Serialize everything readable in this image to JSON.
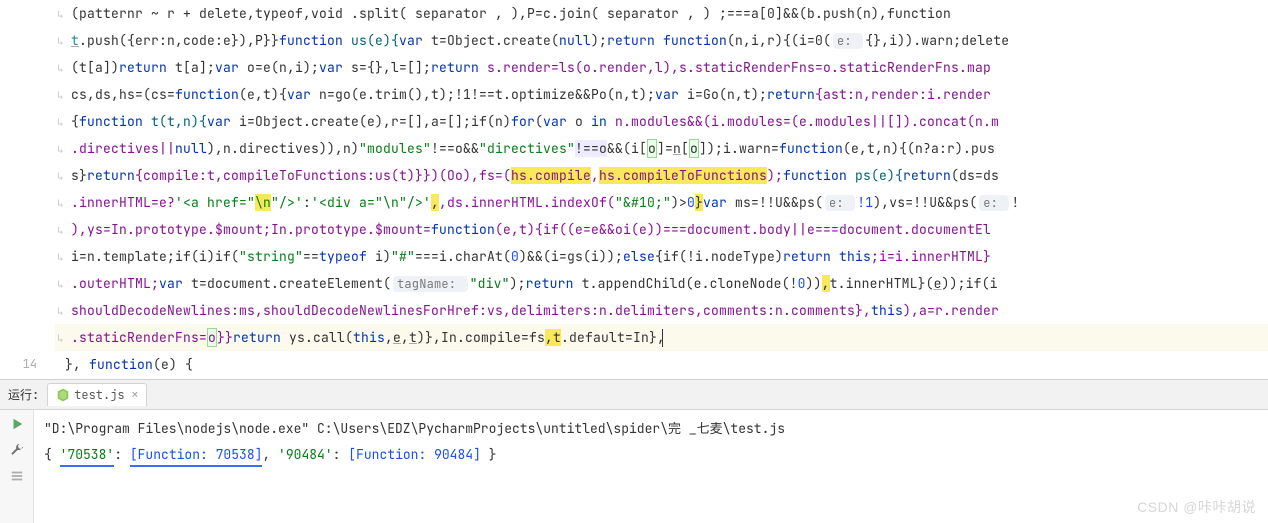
{
  "gutter": {
    "visible_line_number": "14"
  },
  "code": {
    "l1": "(patternr  ~ r + delete,typeof,void .split( separator  , ),P=c.join( separator  , ) ;===a[0]&&(b.push(n),function ",
    "l2_a": "t",
    "l2_b": ".push({err:n,code:e}),P}}",
    "l2_c": "function",
    "l2_d": " us(e){",
    "l2_e": "var",
    "l2_f": " t=Object.create(",
    "l2_g": "null",
    "l2_h": ");",
    "l2_i": "return function",
    "l2_j": "(n,i,r){(i=0(",
    "l2_k": "e: ",
    "l2_l": "{},i)).warn;delete",
    "l3_a": "(t[a])",
    "l3_b": "return",
    "l3_c": " t[a];",
    "l3_d": "var",
    "l3_e": " o=e(n,i);",
    "l3_f": "var",
    "l3_g": " s={},l=[];",
    "l3_h": "return",
    "l3_i": " s.render=ls(o.render,l),s.staticRenderFns=o.staticRenderFns.map",
    "l4_a": "cs,ds,hs=(cs=",
    "l4_b": "function",
    "l4_c": "(e,t){",
    "l4_d": "var",
    "l4_e": " n=go(e.trim(),t);!1!==t.optimize&&Po(n,t);",
    "l4_f": "var",
    "l4_g": " i=Go(n,t);",
    "l4_h": "return",
    "l4_i": "{ast:n,render:i.render",
    "l5_a": "{",
    "l5_b": "function",
    "l5_c": " t(t,n){",
    "l5_d": "var",
    "l5_e": " i=Object.create(e),r=[],a=[];if(n)",
    "l5_f": "for",
    "l5_g": "(",
    "l5_h": "var",
    "l5_i": " o ",
    "l5_j": "in",
    "l5_k": " n.modules&&(i.modules=(e.modules||[]).concat(n.m",
    "l6_a": ".directives||",
    "l6_b": "null",
    "l6_c": "),n.directives)),n)",
    "l6_d": "\"modules\"",
    "l6_e": "!==o&&",
    "l6_f": "\"directives\"",
    "l6_g": "!==o&&(i[o]=n[o]);i.warn=",
    "l6_h": "function",
    "l6_i": "(e,t,n){(n?a:r).pus",
    "l7_a": "s}",
    "l7_b": "return",
    "l7_c": "{compile:t,compileToFunctions:us(t)}})(Oo),fs=(hs.compile,hs.compileToFunctions);",
    "l7_d": "function",
    "l7_e": " ps(e){",
    "l7_f": "return",
    "l7_g": "(ds=ds",
    "l8_a": ".innerHTML=e?",
    "l8_b": "'<a href=\"",
    "l8_c": "\\n",
    "l8_d": "\"/>'",
    "l8_e": ":",
    "l8_f": "'<div a=\"",
    "l8_g": "\\n",
    "l8_h": "\"/>'",
    "l8_i": ",ds.innerHTML.indexOf(",
    "l8_j": "\"&#10;\"",
    "l8_k": ")>",
    "l8_l": "0",
    "l8_m": "}",
    "l8_n": "var",
    "l8_o": " ms=!!U&&ps(",
    "l8_p": "e: ",
    "l8_q": "!1",
    "l8_r": "),vs=!!U&&ps(",
    "l8_s": "e: ",
    "l8_t": "!",
    "l9_a": "),ys=In.prototype.$mount;In.prototype.$mount=",
    "l9_b": "function",
    "l9_c": "(e,t){if((e=e&&oi(e))===document.body||e===document.documentEl",
    "l10_a": "i=n.template;if(i)if(",
    "l10_b": "\"string\"",
    "l10_c": "==",
    "l10_d": "typeof",
    "l10_e": " i)",
    "l10_f": "\"#\"",
    "l10_g": "===i.charAt(",
    "l10_h": "0",
    "l10_i": ")&&(i=gs(i));",
    "l10_j": "else",
    "l10_k": "{if(!i.nodeType)",
    "l10_l": "return this",
    "l10_m": ";i=i.innerHTML}",
    "l11_a": ".outerHTML;",
    "l11_b": "var",
    "l11_c": " t=document.createElement(",
    "l11_d": "tagName: ",
    "l11_e": "\"div\"",
    "l11_f": ");",
    "l11_g": "return",
    "l11_h": " t.appendChild(e.cloneNode(!",
    "l11_i": "0",
    "l11_j": ")),t.innerHTML}(e));if(i",
    "l12_a": "shouldDecodeNewlines:ms,shouldDecodeNewlinesForHref:vs,delimiters:n.delimiters,comments:n.comments},",
    "l12_b": "this",
    "l12_c": "),a=r.render",
    "l13_a": ".staticRenderFns=o}}",
    "l13_b": "return",
    "l13_c": " ys.call(",
    "l13_d": "this",
    "l13_e": ",e,t)},In.compile=fs,t.default=In},",
    "l14_a": "}, ",
    "l14_b": "function",
    "l14_c": "(e) {"
  },
  "run": {
    "label": "运行:",
    "tab_name": "test.js",
    "command": "\"D:\\Program Files\\nodejs\\node.exe\" C:\\Users\\EDZ\\PycharmProjects\\untitled\\spider\\完 _七麦\\test.js",
    "out_prefix": "{ ",
    "out_k1": "'70538'",
    "out_sep1": ": ",
    "out_v1": "[Function: 70538]",
    "out_comma": ", ",
    "out_k2": "'90484'",
    "out_sep2": ": ",
    "out_v2": "[Function: 90484]",
    "out_suffix": " }"
  },
  "watermark": "CSDN @咔咔胡说"
}
